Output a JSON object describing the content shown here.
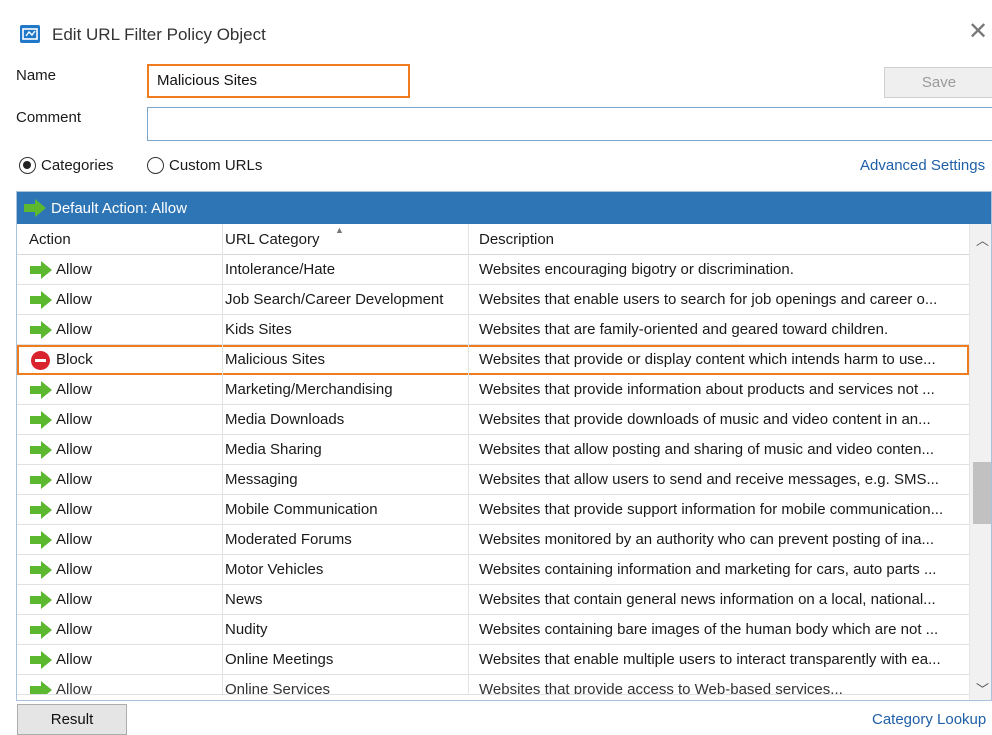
{
  "window": {
    "title": "Edit URL Filter Policy Object",
    "close_glyph": "✕"
  },
  "form": {
    "name_label": "Name",
    "name_value": "Malicious Sites",
    "comment_label": "Comment",
    "comment_value": "",
    "save_label": "Save"
  },
  "mode": {
    "categories_label": "Categories",
    "custom_urls_label": "Custom URLs",
    "selected": "Categories",
    "advanced_settings_label": "Advanced Settings"
  },
  "grid": {
    "default_action_label": "Default Action: Allow",
    "columns": [
      "Action",
      "URL Category",
      "Description"
    ],
    "sorted_column": "URL Category",
    "rows": [
      {
        "action": "Allow",
        "category": "Intolerance/Hate",
        "description": "Websites encouraging bigotry or discrimination."
      },
      {
        "action": "Allow",
        "category": "Job Search/Career Development",
        "description": "Websites that enable users to search for job openings and career o..."
      },
      {
        "action": "Allow",
        "category": "Kids Sites",
        "description": "Websites that are family-oriented and geared toward children."
      },
      {
        "action": "Block",
        "category": "Malicious Sites",
        "description": "Websites that provide or display content which intends harm to use...",
        "selected": true
      },
      {
        "action": "Allow",
        "category": "Marketing/Merchandising",
        "description": "Websites that provide information about products and services not ..."
      },
      {
        "action": "Allow",
        "category": "Media Downloads",
        "description": "Websites that provide downloads of music and video content in an..."
      },
      {
        "action": "Allow",
        "category": "Media Sharing",
        "description": "Websites that allow posting and sharing of music and video conten..."
      },
      {
        "action": "Allow",
        "category": "Messaging",
        "description": "Websites that allow users to send and receive messages, e.g. SMS..."
      },
      {
        "action": "Allow",
        "category": "Mobile Communication",
        "description": "Websites that provide support information for mobile communication..."
      },
      {
        "action": "Allow",
        "category": "Moderated Forums",
        "description": "Websites monitored by an authority who can prevent posting of ina..."
      },
      {
        "action": "Allow",
        "category": "Motor Vehicles",
        "description": "Websites containing information and marketing for cars, auto parts ..."
      },
      {
        "action": "Allow",
        "category": "News",
        "description": "Websites that contain general news information on a local, national..."
      },
      {
        "action": "Allow",
        "category": "Nudity",
        "description": "Websites containing bare images of the human body which are not ..."
      },
      {
        "action": "Allow",
        "category": "Online Meetings",
        "description": "Websites that enable multiple users to interact transparently with ea..."
      },
      {
        "action": "Allow",
        "category": "Online Services",
        "description": "Websites that provide access to Web-based services...",
        "partial": true
      }
    ]
  },
  "footer": {
    "result_label": "Result",
    "category_lookup_label": "Category Lookup"
  },
  "colors": {
    "accent_blue": "#2e75b6",
    "highlight_orange": "#f07c20",
    "allow_green": "#5cb82e",
    "block_red": "#d9232d",
    "link_blue": "#1f5fa8"
  },
  "icons": {
    "app": "window-app-icon",
    "allow": "green-arrow-right-icon",
    "block": "red-no-entry-icon",
    "close": "close-icon"
  }
}
